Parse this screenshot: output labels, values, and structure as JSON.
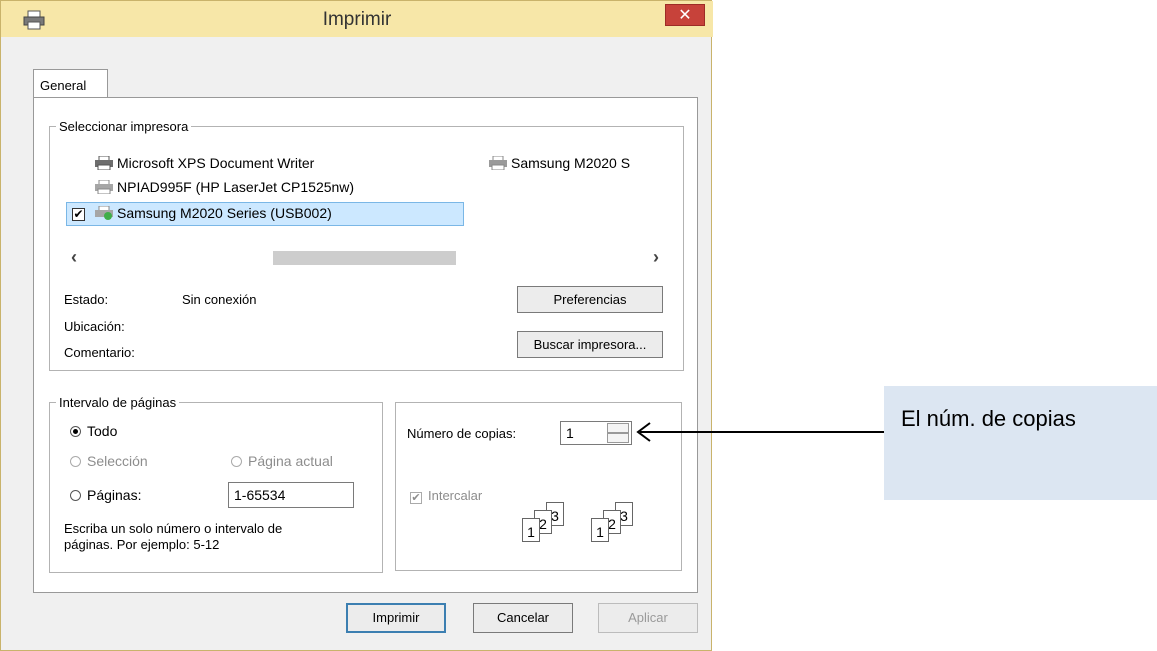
{
  "window": {
    "title": "Imprimir",
    "close_glyph": "✕"
  },
  "tabs": [
    {
      "label": "General"
    }
  ],
  "select_printer": {
    "legend": "Seleccionar impresora",
    "printers": [
      {
        "name": "Microsoft XPS Document Writer",
        "icon": "printer-icon"
      },
      {
        "name": "NPIAD995F (HP LaserJet CP1525nw)",
        "icon": "network-printer-icon"
      },
      {
        "name": "Samsung M2020 Series (USB002)",
        "icon": "default-printer-icon",
        "selected": true,
        "default_mark": "✔"
      },
      {
        "name": "Samsung M2020 S",
        "icon": "printer-icon"
      }
    ],
    "scroll_left": "‹",
    "scroll_right": "›",
    "status_label": "Estado:",
    "status_value": "Sin conexión",
    "location_label": "Ubicación:",
    "comment_label": "Comentario:",
    "preferences_button": "Preferencias",
    "find_printer_button": "Buscar impresora..."
  },
  "page_range": {
    "legend": "Intervalo de páginas",
    "all": "Todo",
    "selection": "Selección",
    "current_page": "Página actual",
    "pages": "Páginas:",
    "pages_value": "1-65534",
    "hint_line1": "Escriba un solo número o intervalo de",
    "hint_line2": "páginas. Por ejemplo: 5-12"
  },
  "copies": {
    "label": "Número de copias:",
    "value": "1",
    "collate": "Intercalar",
    "collate_checked": true,
    "collate_pages": [
      "1",
      "2",
      "3"
    ]
  },
  "buttons": {
    "print": "Imprimir",
    "cancel": "Cancelar",
    "apply": "Aplicar"
  },
  "annotation": {
    "text": "El núm. de copias",
    "arrow_target": "copies-spinner"
  },
  "colors": {
    "title_bar": "#f7e7a8",
    "close_button": "#c7423a",
    "selection": "#cce8ff",
    "note_background": "#dce6f2"
  }
}
